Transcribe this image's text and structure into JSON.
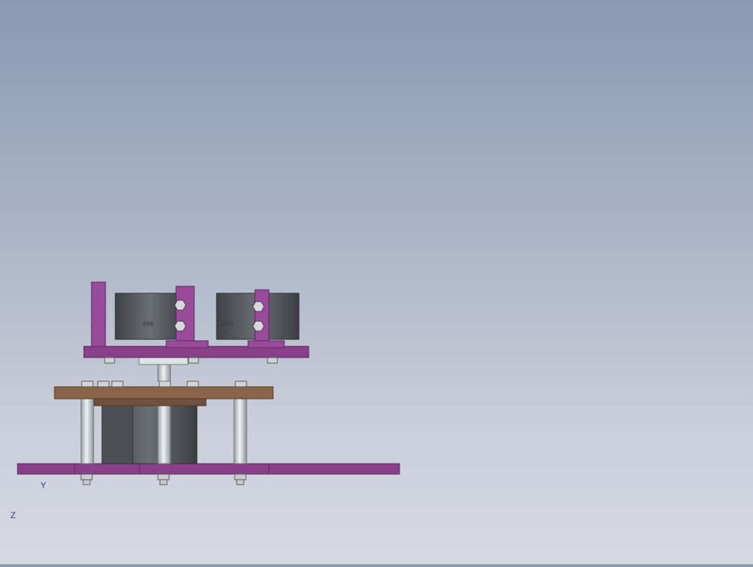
{
  "app": {
    "view": "cad-3d-viewport",
    "model": "robotic-arm-assembly"
  },
  "colors": {
    "background_top": "#8a9ab2",
    "background_bottom": "#d6d9e1",
    "arm_teal": "#1aa6a0",
    "arm_teal_dark": "#0e6f6b",
    "bracket_purple": "#9a4a9a",
    "plate_purple": "#8a3f8a",
    "plate_brown": "#8a6448",
    "bronze": "#a87a55",
    "servo_gray": "#555a60",
    "bolt_silver": "#d8dadc",
    "axis_y_color": "#1fa11f",
    "axis_z_color": "#2a38c8",
    "axis_origin_color": "#e01b1b"
  },
  "triad": {
    "y_label": "Y",
    "z_label": "Z"
  },
  "servo_marks": {
    "mark_1": "996",
    "mark_2": "996"
  }
}
